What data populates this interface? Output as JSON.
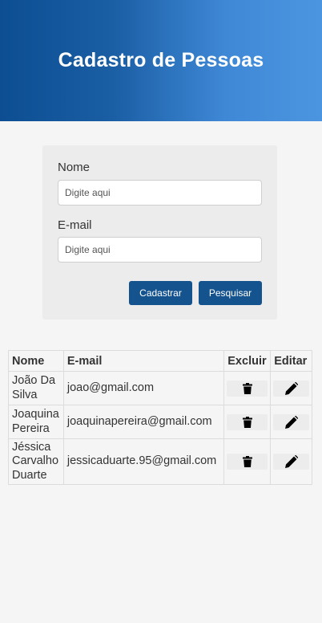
{
  "header": {
    "title": "Cadastro de Pessoas"
  },
  "form": {
    "name_label": "Nome",
    "name_placeholder": "Digite aqui",
    "email_label": "E-mail",
    "email_placeholder": "Digite aqui",
    "submit_label": "Cadastrar",
    "search_label": "Pesquisar"
  },
  "table": {
    "headers": {
      "name": "Nome",
      "email": "E-mail",
      "delete": "Excluir",
      "edit": "Editar"
    },
    "rows": [
      {
        "name": "João Da Silva",
        "email": "joao@gmail.com",
        "delete_icon": "trash-icon",
        "edit_icon": "pencil-icon"
      },
      {
        "name": "Joaquina Pereira",
        "email": "joaquinapereira@gmail.com",
        "delete_icon": "trash-icon",
        "edit_icon": "pencil-icon"
      },
      {
        "name": "Jéssica Carvalho Duarte",
        "email": "jessicaduarte.95@gmail.com",
        "delete_icon": "trash-icon",
        "edit_icon": "pencil-icon"
      }
    ]
  },
  "colors": {
    "primary": "#15538f",
    "header_gradient_start": "#0d4e92",
    "header_gradient_end": "#4b95e0"
  }
}
